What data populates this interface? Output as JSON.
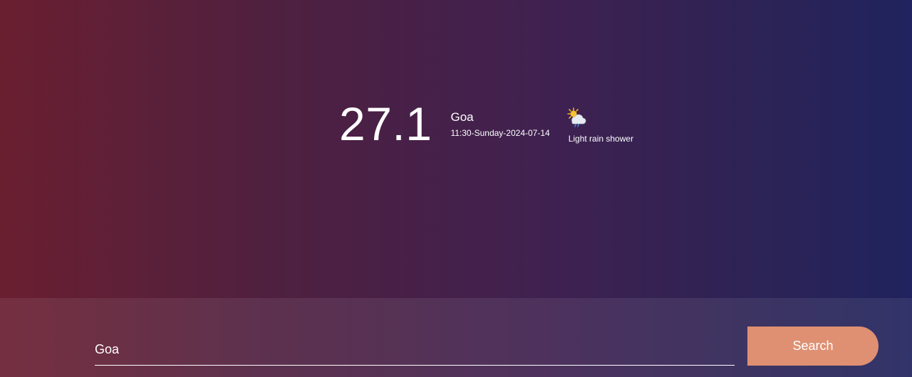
{
  "weather": {
    "temperature": "27.1",
    "city": "Goa",
    "datetime": "11:30-Sunday-2024-07-14",
    "condition_icon": "sun-cloud-rain-icon",
    "condition_text": "Light rain shower"
  },
  "search": {
    "value": "Goa",
    "button_label": "Search"
  },
  "colors": {
    "background_left": "#6a1f30",
    "background_right": "#20235e",
    "button_accent": "#df9072"
  }
}
